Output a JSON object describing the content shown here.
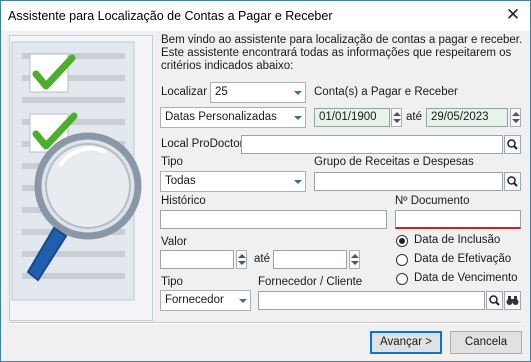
{
  "window": {
    "title": "Assistente para Localização de Contas a Pagar e Receber",
    "close_glyph": "✕"
  },
  "intro": "Bem vindo ao assistente para localização de contas a pagar e receber. Este assistente encontrará todas as informações que respeitarem os critérios indicados abaixo:",
  "localizar": {
    "label": "Localizar",
    "value": "25",
    "suffix": "Conta(s) a Pagar e Receber"
  },
  "periodo": {
    "value": "Datas Personalizadas",
    "date_from": "01/01/1900",
    "ate": "até",
    "date_to": "29/05/2023"
  },
  "local": {
    "label": "Local ProDoctor",
    "value": ""
  },
  "tipo1": {
    "label": "Tipo",
    "value": "Todas"
  },
  "grupo": {
    "label": "Grupo de Receitas e Despesas",
    "value": ""
  },
  "historico": {
    "label": "Histórico",
    "value": ""
  },
  "documento": {
    "label": "Nº Documento",
    "value": ""
  },
  "valor": {
    "label": "Valor",
    "from": "",
    "ate": "até",
    "to": ""
  },
  "date_options": [
    {
      "label": "Data de Inclusão",
      "selected": true
    },
    {
      "label": "Data de Efetivação",
      "selected": false
    },
    {
      "label": "Data de Vencimento",
      "selected": false
    }
  ],
  "tipo2": {
    "label": "Tipo",
    "value": "Fornecedor"
  },
  "fornecedor": {
    "label": "Fornecedor / Cliente",
    "value": ""
  },
  "buttons": {
    "next": "Avançar >",
    "cancel": "Cancela"
  },
  "colors": {
    "accent": "#0078d7",
    "date_bg": "#e6f2ea",
    "error_underline": "#d42020",
    "check_green": "#4caf2a"
  }
}
